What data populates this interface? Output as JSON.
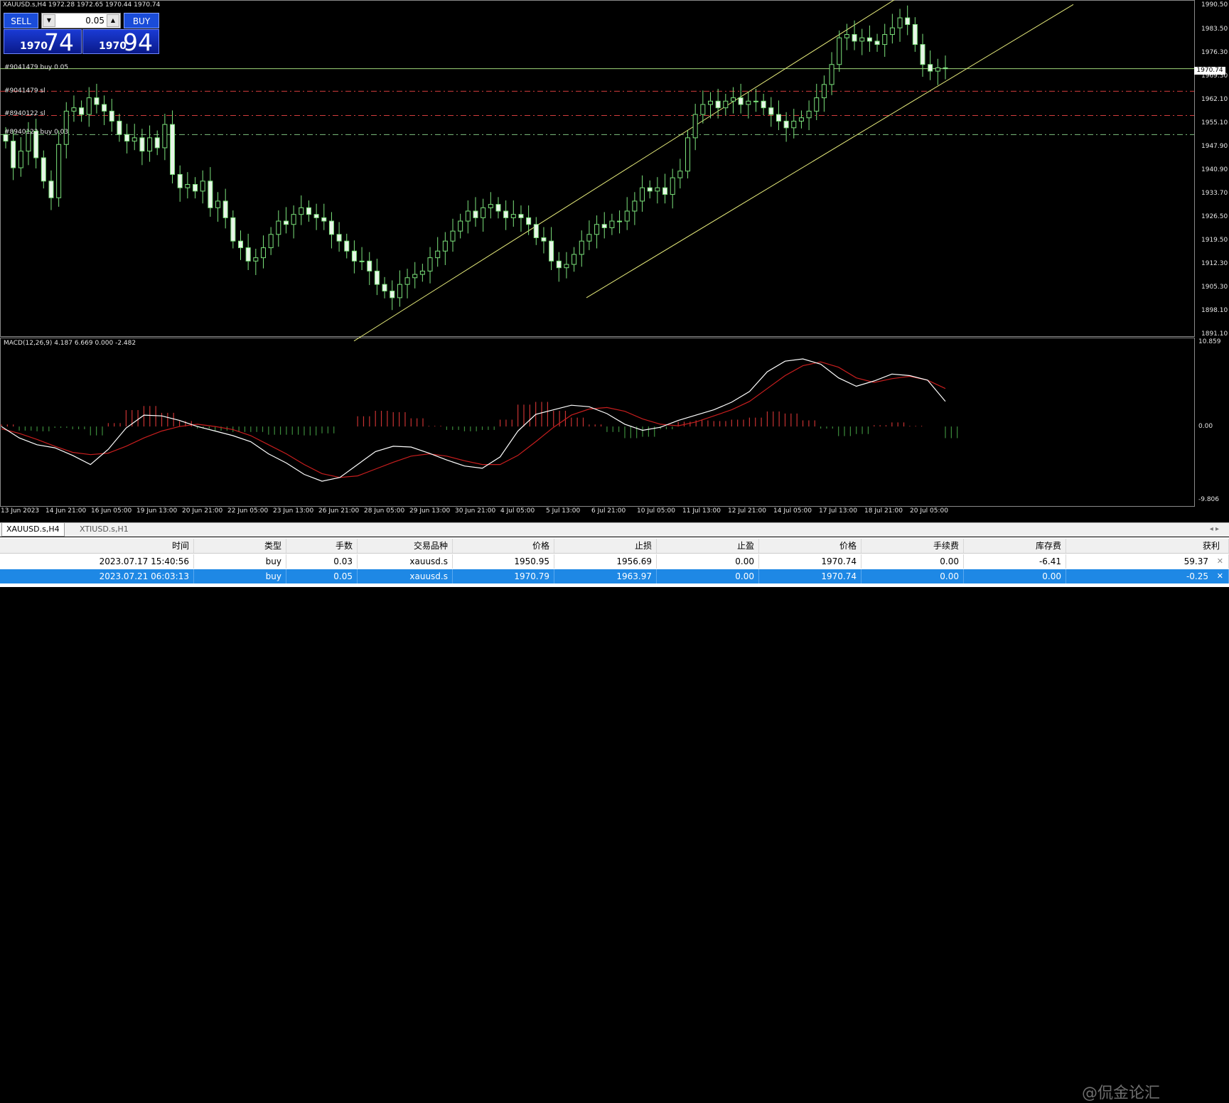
{
  "window": {
    "title": "XAUUSD.s,H4  1972.28 1972.65 1970.44 1970.74"
  },
  "trade_panel": {
    "sell_label": "SELL",
    "buy_label": "BUY",
    "lot_value": "0.05",
    "sell_price_small": "1970",
    "sell_price_big": "74",
    "buy_price_small": "1970",
    "buy_price_big": "94"
  },
  "order_lines": [
    {
      "label": "#9041479 buy 0.05",
      "price": 1970.74,
      "color": "#9fd67a"
    },
    {
      "label": "#9041479 sl",
      "price": 1963.97,
      "color": "#d23c3c"
    },
    {
      "label": "#8940122 sl",
      "price": 1956.69,
      "color": "#d23c3c"
    },
    {
      "label": "#8940122 buy 0.03",
      "price": 1950.95,
      "color": "#7fc27f"
    }
  ],
  "price_axis": {
    "labels": [
      "1990.50",
      "1983.50",
      "1976.30",
      "1969.30",
      "1962.10",
      "1955.10",
      "1947.90",
      "1940.90",
      "1933.70",
      "1926.50",
      "1919.50",
      "1912.30",
      "1905.30",
      "1898.10",
      "1891.10"
    ],
    "current_price": "1970.74"
  },
  "macd": {
    "label": "MACD(12,26,9) 4.187 6.669 0.000 -2.482",
    "axis_labels": [
      "10.859",
      "0.00",
      "-9.806"
    ],
    "main_color": "#ffffff",
    "signal_color": "#c81e1e",
    "hist_pos_color": "#c83232",
    "hist_neg_color": "#3c8c3c",
    "main": [
      0,
      -1.5,
      -2.4,
      -2.8,
      -3.8,
      -5.0,
      -3.0,
      -0.2,
      1.5,
      1.4,
      0.8,
      0.0,
      -0.6,
      -1.2,
      -2.0,
      -3.6,
      -4.8,
      -6.3,
      -7.2,
      -6.7,
      -5.0,
      -3.3,
      -2.6,
      -2.7,
      -3.5,
      -4.4,
      -5.2,
      -5.5,
      -4.0,
      -0.6,
      1.6,
      2.2,
      2.8,
      2.6,
      1.7,
      0.3,
      -0.5,
      -0.1,
      0.8,
      1.5,
      2.2,
      3.2,
      4.6,
      7.2,
      8.6,
      8.9,
      8.2,
      6.4,
      5.3,
      6.0,
      6.9,
      6.7,
      6.1,
      3.3
    ],
    "signal": [
      -0.3,
      -0.9,
      -1.7,
      -2.6,
      -3.4,
      -3.7,
      -3.5,
      -2.6,
      -1.5,
      -0.6,
      0.0,
      0.3,
      0.0,
      -0.4,
      -1.2,
      -2.4,
      -3.6,
      -5.0,
      -6.2,
      -6.7,
      -6.5,
      -5.6,
      -4.7,
      -3.9,
      -3.6,
      -3.9,
      -4.5,
      -5.0,
      -5.0,
      -3.8,
      -2.0,
      -0.1,
      1.5,
      2.3,
      2.5,
      2.0,
      1.0,
      0.3,
      0.1,
      0.6,
      1.4,
      2.2,
      3.3,
      5.0,
      6.7,
      8.0,
      8.5,
      7.8,
      6.4,
      5.8,
      6.3,
      6.6,
      6.1,
      5.0
    ],
    "range": [
      -9.806,
      10.859
    ]
  },
  "time_axis": {
    "labels": [
      "13 Jun 2023",
      "14 Jun 21:00",
      "16 Jun 05:00",
      "19 Jun 13:00",
      "20 Jun 21:00",
      "22 Jun 05:00",
      "23 Jun 13:00",
      "26 Jun 21:00",
      "28 Jun 05:00",
      "29 Jun 13:00",
      "30 Jun 21:00",
      "4 Jul 05:00",
      "5 Jul 13:00",
      "6 Jul 21:00",
      "10 Jul 05:00",
      "11 Jul 13:00",
      "12 Jul 21:00",
      "14 Jul 05:00",
      "17 Jul 13:00",
      "18 Jul 21:00",
      "20 Jul 05:00"
    ]
  },
  "chart_data": {
    "type": "line",
    "title": "XAUUSD.s,H4",
    "price_range": [
      1891.1,
      1990.5
    ],
    "closes": [
      1949,
      1941,
      1946,
      1952,
      1944,
      1937,
      1932,
      1948,
      1958,
      1959,
      1957,
      1962,
      1960,
      1958,
      1955,
      1951,
      1949,
      1950,
      1946,
      1950,
      1947,
      1954,
      1939,
      1935,
      1936,
      1934,
      1937,
      1929,
      1931,
      1926,
      1919,
      1917,
      1913,
      1914,
      1917,
      1921,
      1925,
      1924,
      1927,
      1929,
      1927,
      1926,
      1925,
      1921,
      1919,
      1916,
      1913,
      1913,
      1910,
      1906,
      1904,
      1902,
      1906,
      1908,
      1909,
      1910,
      1914,
      1916,
      1919,
      1922,
      1925,
      1928,
      1926,
      1929,
      1930,
      1928,
      1926,
      1927,
      1926,
      1924,
      1920,
      1919,
      1913,
      1911,
      1912,
      1915,
      1919,
      1921,
      1924,
      1923,
      1925,
      1925,
      1928,
      1931,
      1935,
      1934,
      1935,
      1933,
      1938,
      1940,
      1950,
      1957,
      1960,
      1961,
      1959,
      1961,
      1962,
      1960,
      1961,
      1961,
      1959,
      1957,
      1955,
      1953,
      1955,
      1956,
      1958,
      1962,
      1966,
      1972,
      1980,
      1981,
      1979,
      1980,
      1979,
      1978,
      1981,
      1983,
      1986,
      1984,
      1978,
      1972,
      1970,
      1971,
      1970.74
    ],
    "channel_upper": {
      "from_price": 1889,
      "to_price": 1993
    },
    "channel_lower": {
      "from_price": 1902,
      "to_price": 1990
    }
  },
  "tabs": {
    "items": [
      "XAUUSD.s,H4",
      "XTIUSD.s,H1"
    ],
    "arrows": "◂ ▸"
  },
  "terminal": {
    "columns": [
      "时间",
      "类型",
      "手数",
      "交易品种",
      "价格",
      "止损",
      "止盈",
      "价格",
      "手续费",
      "库存费",
      "获利"
    ],
    "rows": [
      [
        "2023.07.17 15:40:56",
        "buy",
        "0.03",
        "xauusd.s",
        "1950.95",
        "1956.69",
        "0.00",
        "1970.74",
        "0.00",
        "-6.41",
        "59.37"
      ],
      [
        "2023.07.21 06:03:13",
        "buy",
        "0.05",
        "xauusd.s",
        "1970.79",
        "1963.97",
        "0.00",
        "1970.74",
        "0.00",
        "0.00",
        "-0.25"
      ]
    ],
    "close_glyph": "✕"
  },
  "watermark": "@侃金论汇"
}
